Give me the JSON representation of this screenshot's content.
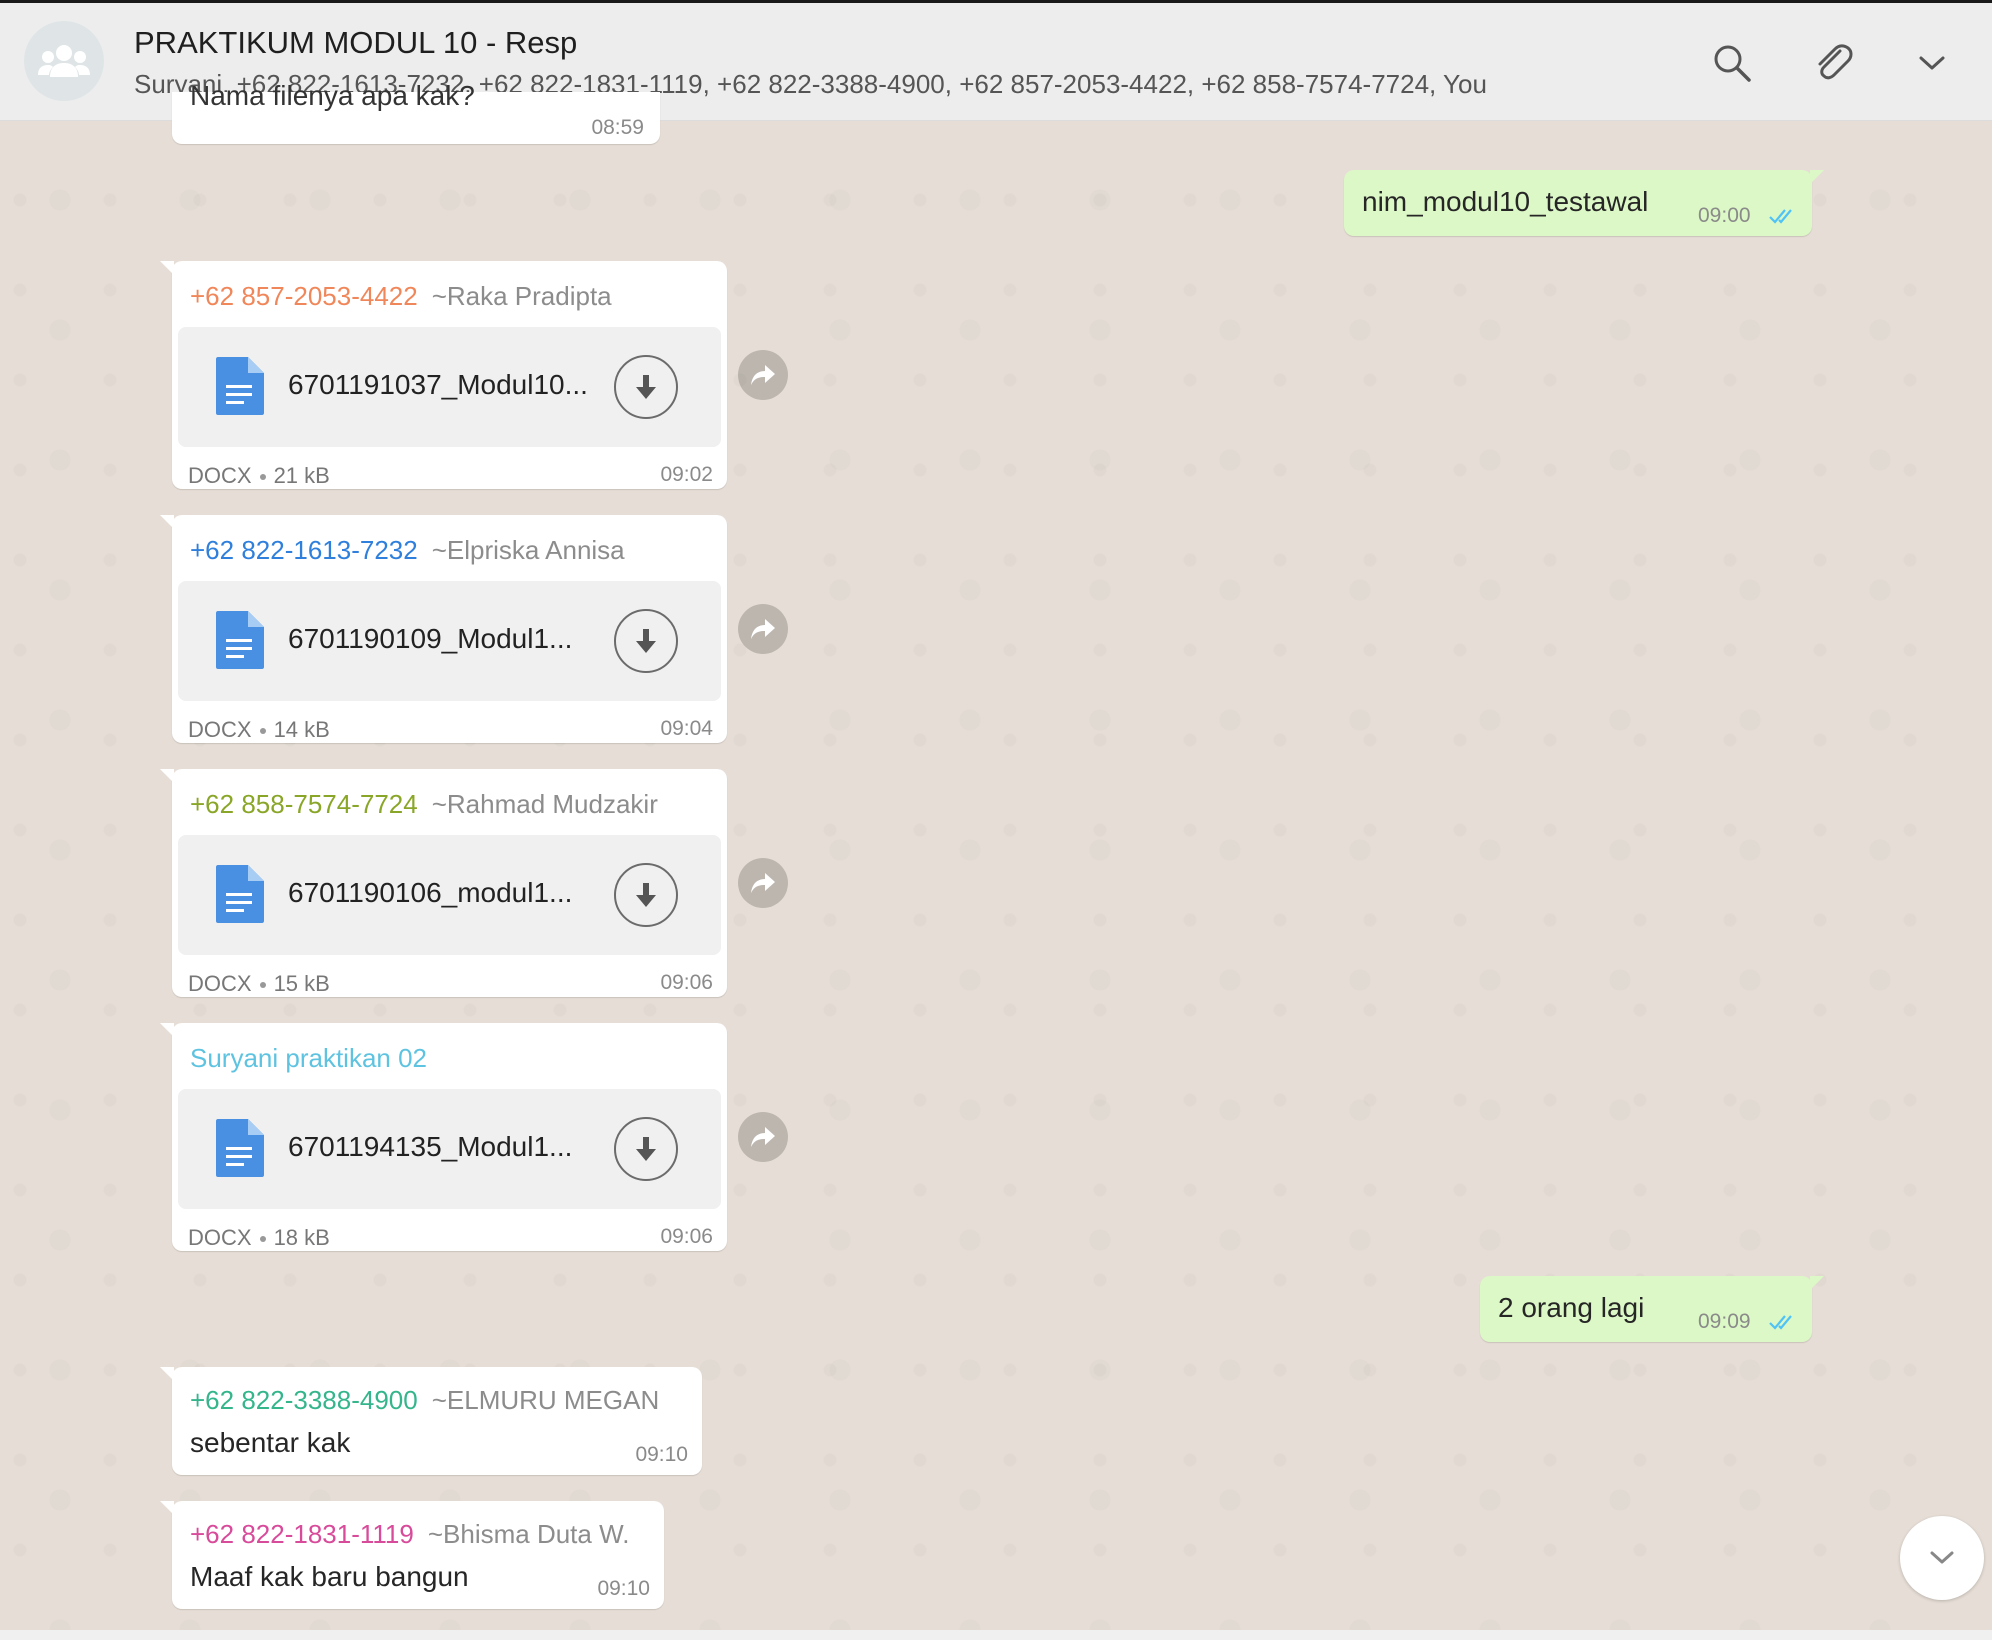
{
  "header": {
    "title": "PRAKTIKUM MODUL 10 - Resp",
    "participants": "Suryani, +62 822-1613-7232, +62 822-1831-1119, +62 822-3388-4900, +62 857-2053-4422, +62 858-7574-7724, You",
    "icons": [
      "group-avatar-icon",
      "search-icon",
      "paperclip-icon",
      "chevron-down-icon"
    ]
  },
  "colors": {
    "outgoing_bubble": "#dcf8c6",
    "incoming_bubble": "#ffffff",
    "read_ticks": "#4fc3f7",
    "doc_icon": "#4a90e2"
  },
  "messages": {
    "partial_top": {
      "text": "Nama filenya apa kak?",
      "time": "08:59"
    },
    "out1": {
      "text": "nim_modul10_testawal",
      "time": "09:00"
    },
    "doc1": {
      "phone": "+62 857-2053-4422",
      "alias": "~Raka Pradipta",
      "phone_color": "#f0875a",
      "filename": "6701191037_Modul10...",
      "type": "DOCX",
      "size": "21 kB",
      "time": "09:02"
    },
    "doc2": {
      "phone": "+62 822-1613-7232",
      "alias": "~Elpriska Annisa",
      "phone_color": "#2f7fdc",
      "filename": "6701190109_Modul1...",
      "type": "DOCX",
      "size": "14 kB",
      "time": "09:04"
    },
    "doc3": {
      "phone": "+62 858-7574-7724",
      "alias": "~Rahmad Mudzakir",
      "phone_color": "#8aa628",
      "filename": "6701190106_modul1...",
      "type": "DOCX",
      "size": "15 kB",
      "time": "09:06"
    },
    "doc4": {
      "sender": "Suryani praktikan 02",
      "sender_color": "#5ec3e0",
      "filename": "6701194135_Modul1...",
      "type": "DOCX",
      "size": "18 kB",
      "time": "09:06"
    },
    "out2": {
      "text": "2 orang lagi",
      "time": "09:09"
    },
    "in1": {
      "phone": "+62 822-3388-4900",
      "alias": "~ELMURU MEGAN",
      "phone_color": "#35b58c",
      "text": "sebentar kak",
      "time": "09:10"
    },
    "in2": {
      "phone": "+62 822-1831-1119",
      "alias": "~Bhisma Duta W.",
      "phone_color": "#d84a9a",
      "text": "Maaf kak baru bangun",
      "time": "09:10"
    }
  }
}
